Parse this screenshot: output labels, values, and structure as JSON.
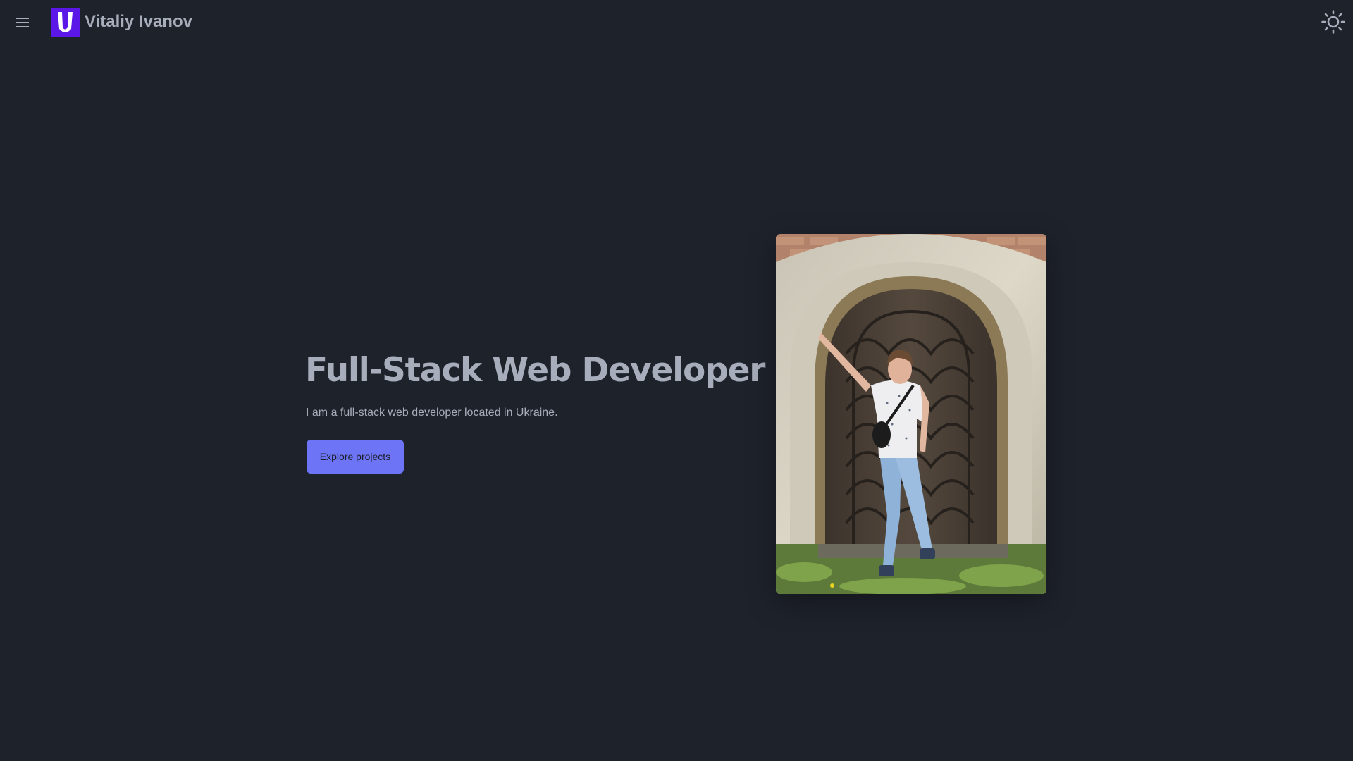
{
  "header": {
    "brand_name": "Vitaliy Ivanov",
    "menu_icon": "hamburger-menu-icon",
    "theme_icon": "sun-icon"
  },
  "hero": {
    "title": "Full-Stack Web Developer",
    "subtitle": "I am a full-stack web developer located in Ukraine.",
    "cta_label": "Explore projects"
  },
  "colors": {
    "background": "#1e222b",
    "text": "#a8adbb",
    "accent": "#6d75f6",
    "logo_bg": "#5b16e8"
  }
}
